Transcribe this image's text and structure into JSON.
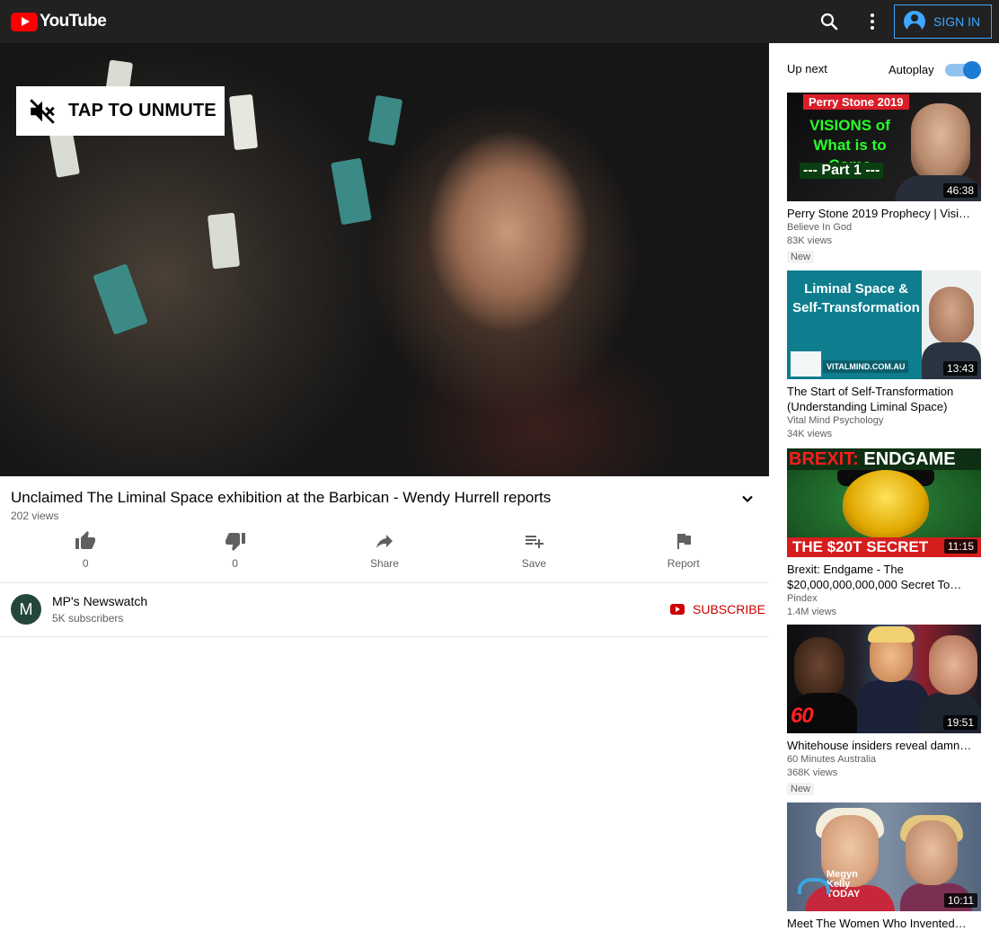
{
  "header": {
    "logo_text": "YouTube",
    "signin_label": "SIGN IN"
  },
  "player": {
    "unmute_label": "TAP TO UNMUTE"
  },
  "video": {
    "title": "Unclaimed The Liminal Space exhibition at the Barbican - Wendy Hurrell reports",
    "views": "202 views"
  },
  "actions": [
    {
      "label": "0",
      "icon": "thumbs-up-icon"
    },
    {
      "label": "0",
      "icon": "thumbs-down-icon"
    },
    {
      "label": "Share",
      "icon": "share-icon"
    },
    {
      "label": "Save",
      "icon": "playlist-add-icon"
    },
    {
      "label": "Report",
      "icon": "flag-icon"
    }
  ],
  "channel": {
    "avatar_letter": "M",
    "avatar_color": "#23473a",
    "name": "MP's Newswatch",
    "subscribers": "5K subscribers",
    "subscribe_label": "SUBSCRIBE"
  },
  "sidebar": {
    "up_next": "Up next",
    "autoplay_label": "Autoplay",
    "autoplay_on": true,
    "videos": [
      {
        "title": "Perry Stone 2019 Prophecy | Visi…",
        "channel": "Believe In God",
        "views": "83K views",
        "badge": "New",
        "duration": "46:38",
        "thumb_text": {
          "line1": "Perry Stone 2019",
          "line2": "VISIONS of What is to Come",
          "line3": "--- Part 1 ---"
        }
      },
      {
        "title": "The Start of Self-Transformation (Understanding Liminal Space)",
        "channel": "Vital Mind Psychology",
        "views": "34K views",
        "duration": "13:43",
        "thumb_text": {
          "line1": "Liminal Space & Self-Transformation",
          "line2": "VITALMIND.COM.AU"
        }
      },
      {
        "title": "Brexit: Endgame - The $20,000,000,000,000 Secret To…",
        "channel": "Pindex",
        "views": "1.4M views",
        "duration": "11:15",
        "thumb_text": {
          "line1a": "BREXIT:",
          "line1b": " ENDGAME",
          "line2": "THE $20T SECRET"
        }
      },
      {
        "title": "Whitehouse insiders reveal damn…",
        "channel": "60 Minutes Australia",
        "views": "368K views",
        "badge": "New",
        "duration": "19:51",
        "thumb_text": {
          "line1": "60"
        }
      },
      {
        "title": "Meet The Women Who Invented…",
        "duration": "10:11",
        "thumb_text": {
          "line1": "Megyn Kelly TODAY"
        }
      }
    ]
  }
}
